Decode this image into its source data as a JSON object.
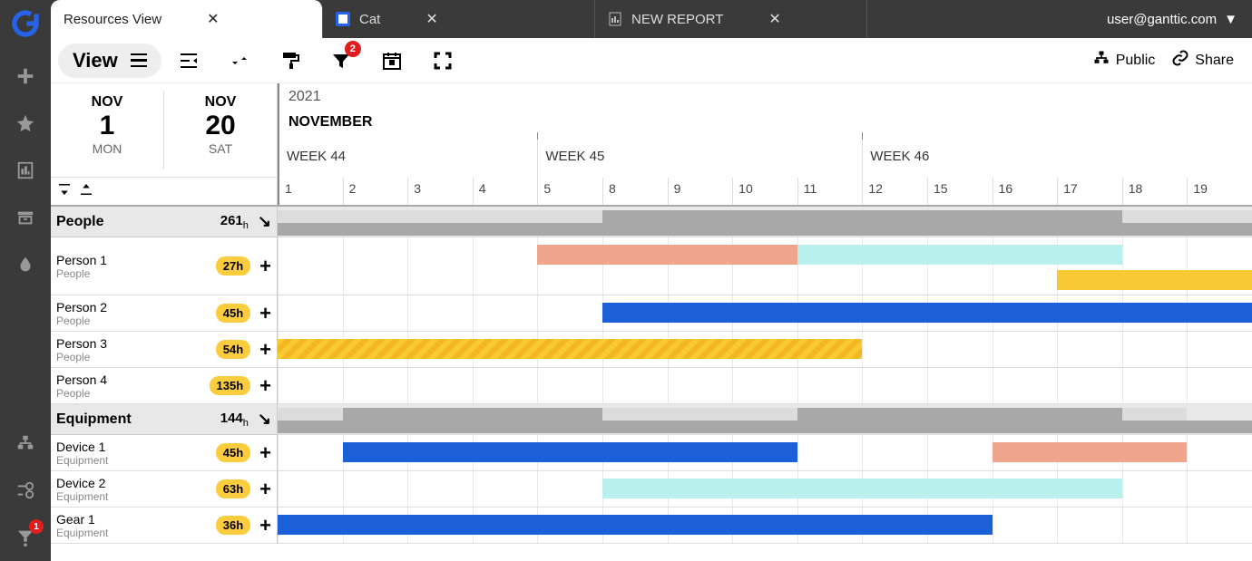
{
  "tabs": {
    "resources": "Resources View",
    "cat": "Cat",
    "report": "NEW REPORT"
  },
  "user": "user@ganttic.com",
  "toolbar": {
    "view": "View",
    "filter_count": "2",
    "public": "Public",
    "share": "Share"
  },
  "dates": {
    "start_month": "NOV",
    "start_day": "1",
    "start_wd": "MON",
    "end_month": "NOV",
    "end_day": "20",
    "end_wd": "SAT",
    "year": "2021",
    "month_label": "NOVEMBER",
    "weeks": [
      "WEEK 44",
      "WEEK 45",
      "WEEK 46"
    ],
    "days": [
      "1",
      "2",
      "3",
      "4",
      "5",
      "8",
      "9",
      "10",
      "11",
      "12",
      "15",
      "16",
      "17",
      "18",
      "19"
    ]
  },
  "groups": [
    {
      "name": "People",
      "hours": "261",
      "hours_unit": "h"
    },
    {
      "name": "Equipment",
      "hours": "144",
      "hours_unit": "h"
    }
  ],
  "people": [
    {
      "name": "Person 1",
      "group": "People",
      "hours": "27h"
    },
    {
      "name": "Person 2",
      "group": "People",
      "hours": "45h"
    },
    {
      "name": "Person 3",
      "group": "People",
      "hours": "54h"
    },
    {
      "name": "Person 4",
      "group": "People",
      "hours": "135h"
    }
  ],
  "equipment": [
    {
      "name": "Device 1",
      "group": "Equipment",
      "hours": "45h"
    },
    {
      "name": "Device 2",
      "group": "Equipment",
      "hours": "63h"
    },
    {
      "name": "Gear 1",
      "group": "Equipment",
      "hours": "36h"
    }
  ],
  "sidebar_help_badge": "1"
}
